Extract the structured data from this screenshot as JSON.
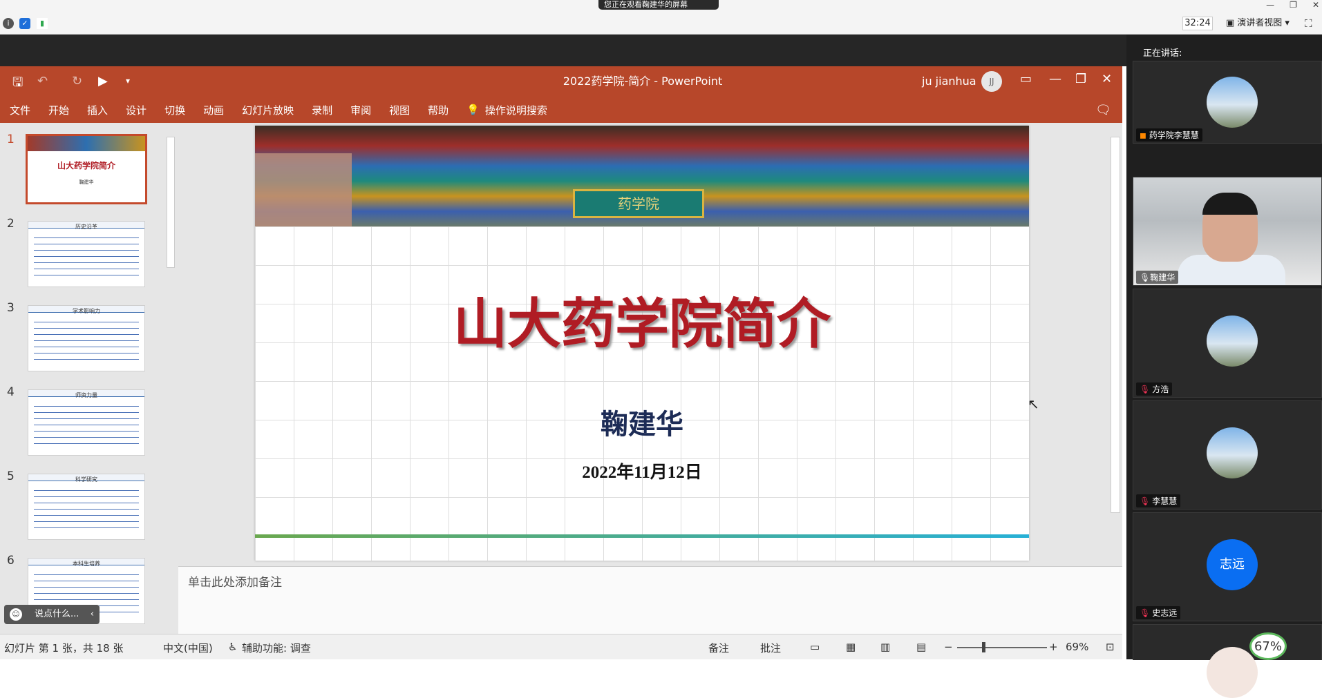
{
  "share_banner": "您正在观看鞠建华的屏幕",
  "topbar": {
    "timer": "32:24",
    "presenter_view": "演讲者视图"
  },
  "powerpoint": {
    "doc_title": "2022药学院-简介  -  PowerPoint",
    "user_name": "ju jianhua",
    "user_initials": "JJ",
    "menu": [
      "文件",
      "开始",
      "插入",
      "设计",
      "切换",
      "动画",
      "幻灯片放映",
      "录制",
      "审阅",
      "视图",
      "帮助"
    ],
    "search_label": "操作说明搜索",
    "thumbnails": [
      {
        "num": "1",
        "title": "山大药学院简介"
      },
      {
        "num": "2",
        "title": "历史沿革"
      },
      {
        "num": "3",
        "title": "学术影响力"
      },
      {
        "num": "4",
        "title": "师资力量"
      },
      {
        "num": "5",
        "title": "科学研究"
      },
      {
        "num": "6",
        "title": "本科生培养"
      }
    ],
    "slide": {
      "plaque": "药学院",
      "title": "山大药学院简介",
      "author": "鞠建华",
      "date": "2022年11月12日"
    },
    "notes_placeholder": "单击此处添加备注",
    "status": {
      "slide_info": "幻灯片 第 1 张，共 18 张",
      "language": "中文(中国)",
      "accessibility": "辅助功能: 调查",
      "notes_btn": "备注",
      "comments_btn": "批注",
      "zoom": "69%"
    },
    "comment_box": "说点什么..."
  },
  "sidebar": {
    "speaking": "正在讲话:",
    "participants": [
      {
        "name": "药学院李慧慧"
      },
      {
        "name": "鞠建华"
      },
      {
        "name": "方浩"
      },
      {
        "name": "李慧慧"
      },
      {
        "name": "史志远",
        "avatar_text": "志远"
      }
    ],
    "percent": "67%"
  }
}
